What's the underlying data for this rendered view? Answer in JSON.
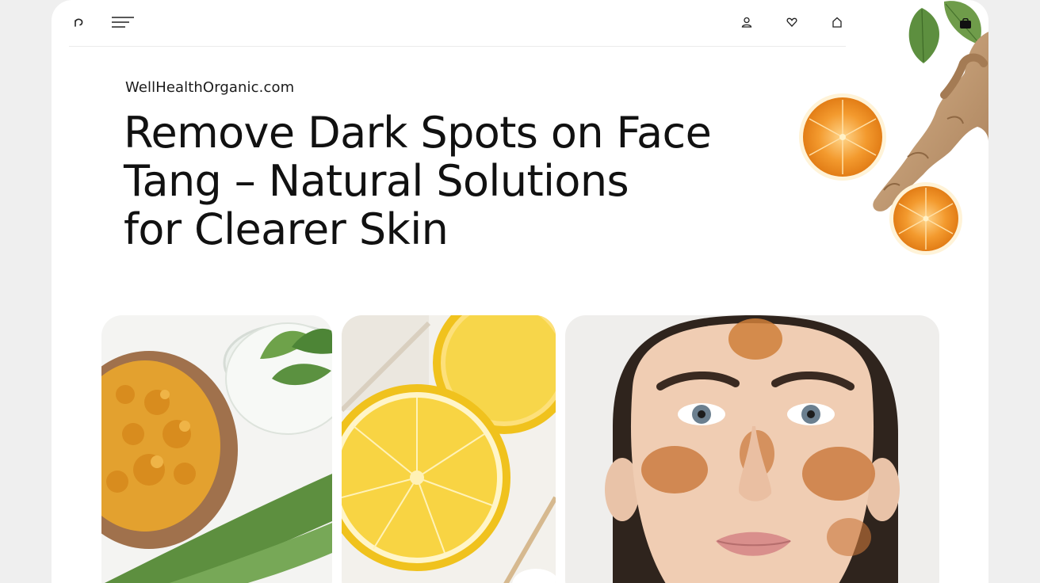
{
  "site": {
    "label": "WellHealthOrganic.com"
  },
  "headline": {
    "lines": [
      "Remove Dark Spots on Face",
      "Tang – Natural Solutions",
      "for Clearer Skin"
    ]
  },
  "nav": {
    "icons": [
      "refresh-icon",
      "menu-icon",
      "user-icon",
      "heart-icon",
      "home-icon",
      "bag-icon"
    ]
  },
  "photos": [
    {
      "subject": "turmeric-powder-bowl-and-aloe-vera"
    },
    {
      "subject": "lemon-halves"
    },
    {
      "subject": "woman-face-with-turmeric-mask"
    }
  ],
  "colors": {
    "page_bg": "#efefef",
    "card_bg": "#ffffff",
    "text": "#111111",
    "turmeric": "#e19a2a",
    "lemon": "#f6cf3a",
    "orange": "#f29a2e",
    "leaf": "#5d8f3f"
  }
}
